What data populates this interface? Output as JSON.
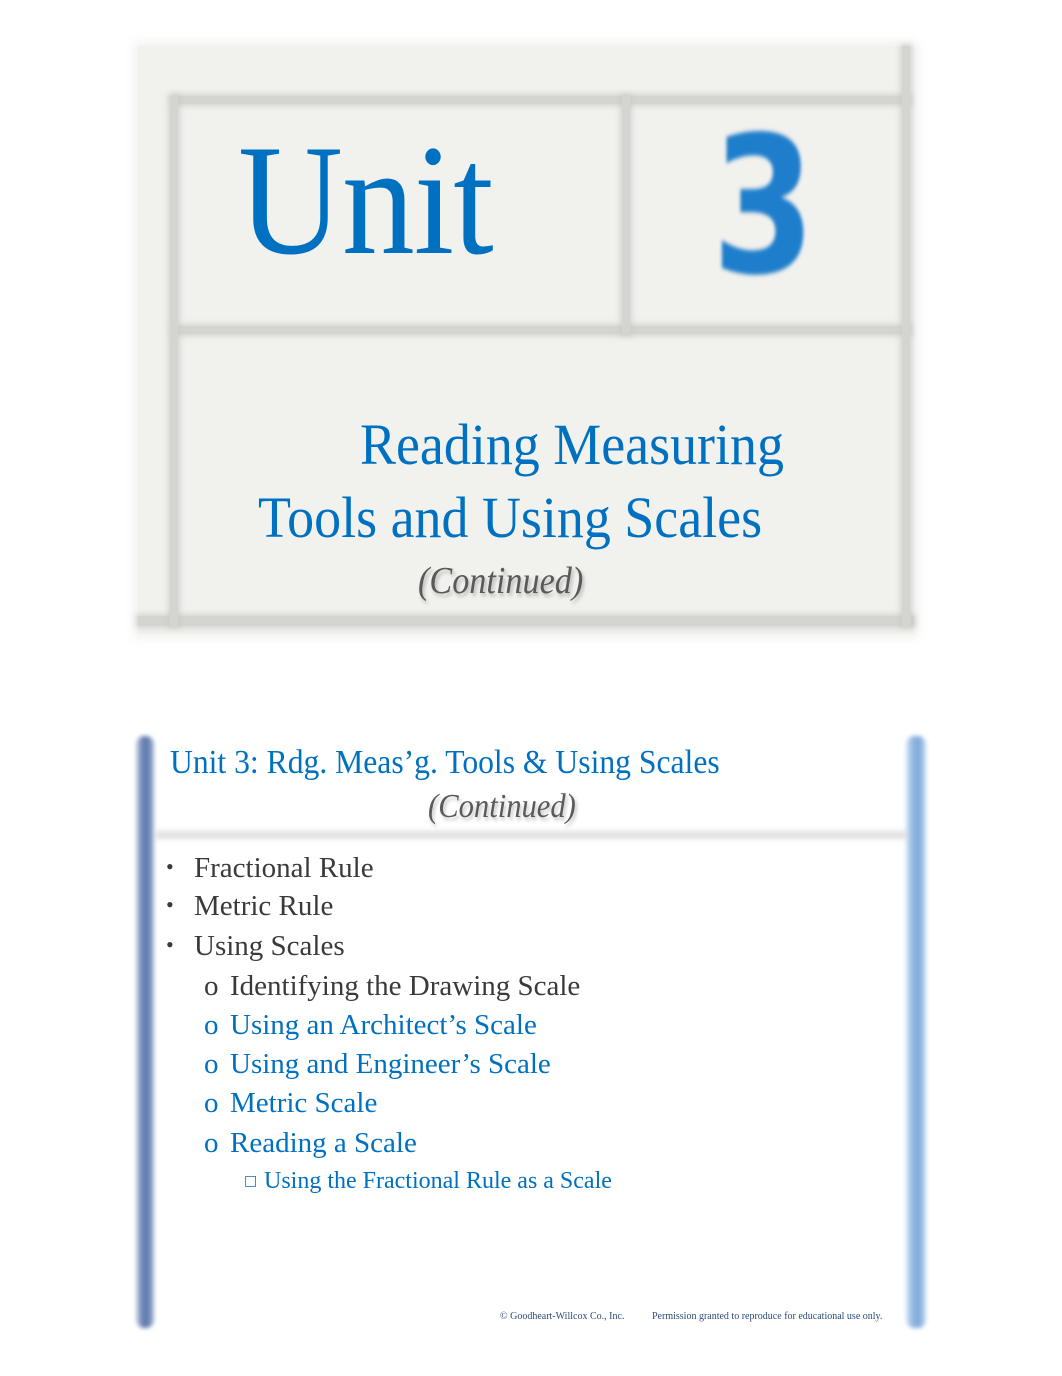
{
  "title_slide": {
    "unit_word": "Unit",
    "unit_number": "3",
    "title_line1": "Reading Measuring",
    "title_line2": "Tools and Using Scales",
    "continued": "(Continued)"
  },
  "content_slide": {
    "title": "Unit 3: Rdg. Meas’g. Tools & Using Scales",
    "continued": "(Continued)",
    "bullets": [
      {
        "level": 1,
        "marker": "•",
        "text": "Fractional Rule"
      },
      {
        "level": 1,
        "marker": "•",
        "text": "Metric Rule"
      },
      {
        "level": 1,
        "marker": "•",
        "text": "Using Scales"
      },
      {
        "level": 2,
        "marker": "o",
        "text": "Identifying the Drawing Scale"
      },
      {
        "level": 2,
        "marker": "o",
        "text": "Using an Architect’s Scale"
      },
      {
        "level": 2,
        "marker": "o",
        "text": "Using and Engineer’s Scale"
      },
      {
        "level": 2,
        "marker": "o",
        "text": "Metric Scale"
      },
      {
        "level": 2,
        "marker": "o",
        "text": "Reading a Scale"
      },
      {
        "level": 3,
        "marker": "□",
        "text": "Using the Fractional Rule as a Scale"
      }
    ],
    "footer": {
      "copyright": "© Goodheart-Willcox Co., Inc.",
      "permission": "Permission granted to reproduce for educational use only."
    }
  },
  "colors": {
    "accent_blue": "#0070c0",
    "number_blue": "#1f7ecb",
    "body_text": "#3a3a3a",
    "continued_gray": "#5a5a5a",
    "left_bar": "#5a76aa",
    "right_bar": "#7eaad9",
    "title_slide_bg": "#f1f1ee"
  }
}
